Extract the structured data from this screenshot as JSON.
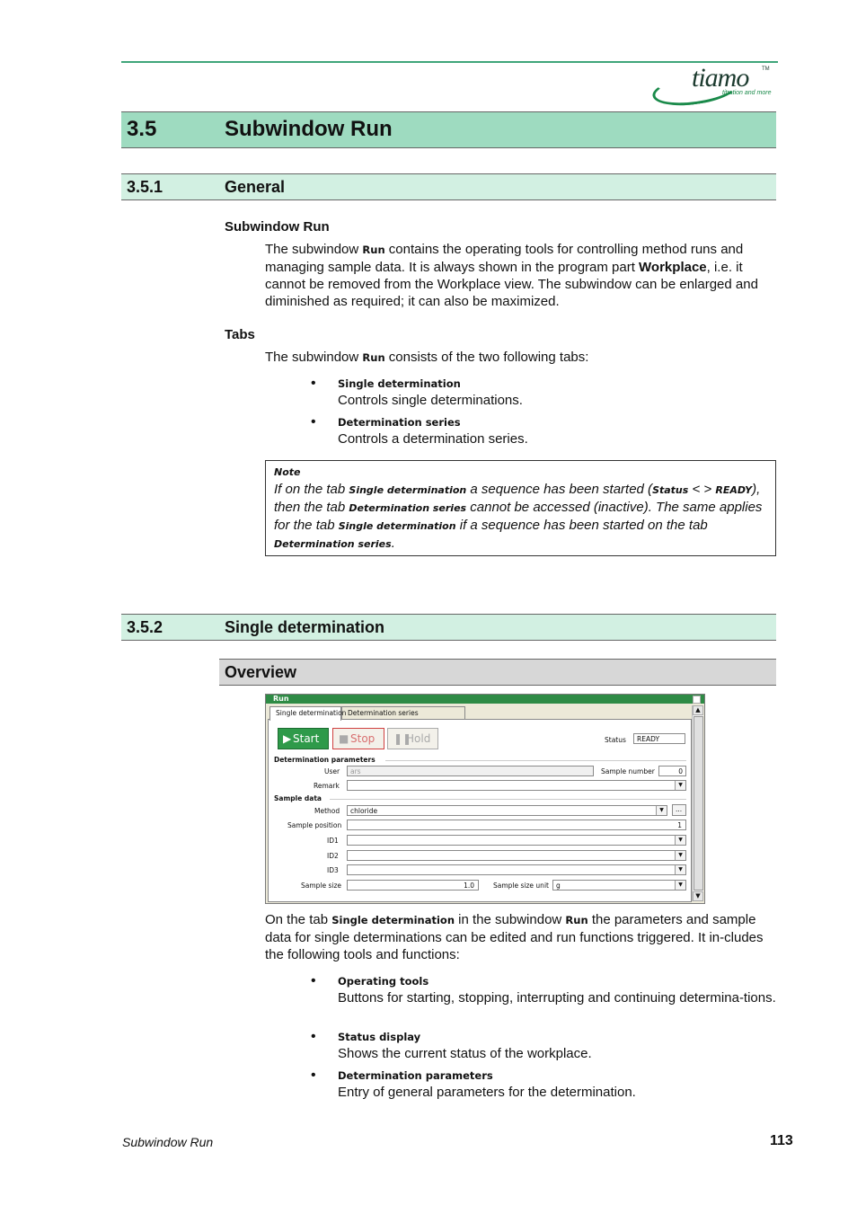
{
  "header": {
    "logo": {
      "word": "tiamo",
      "trademark": "TM",
      "tagline": "titration and more"
    }
  },
  "section": {
    "number": "3.5",
    "title": "Subwindow Run"
  },
  "general": {
    "number": "3.5.1",
    "title": "General",
    "subhead1": "Subwindow Run",
    "para1": {
      "t1": "The subwindow ",
      "ui1": "Run",
      "t2": " contains the operating tools for controlling method runs and managing sample data. It is always shown in the program part ",
      "b1": "Workplace",
      "t3": ", i.e. it cannot be removed from the Workplace view. The subwindow can be enlarged and diminished as required; it can also be maximized."
    },
    "subhead2": "Tabs",
    "para2": {
      "t1": "The subwindow ",
      "ui1": "Run",
      "t2": " consists of the two following tabs:"
    },
    "bullets": [
      {
        "title": "Single determination",
        "desc": "Controls single determinations."
      },
      {
        "title": "Determination series",
        "desc": "Controls a determination series."
      }
    ],
    "note": {
      "title": "Note",
      "t1": "If on the tab ",
      "ui1": "Single determination",
      "t2": " a sequence has been started (",
      "ui2": "Status",
      "t3": " < > ",
      "ui3": "READY",
      "t4": "), then the tab ",
      "ui4": "Determination series",
      "t5": " cannot be accessed (inactive). The same applies for the tab ",
      "ui5": "Single determination",
      "t6": " if a sequence has been started on the tab ",
      "ui6": "Determination series",
      "t7": "."
    }
  },
  "single": {
    "number": "3.5.2",
    "title": "Single determination",
    "overview": "Overview",
    "window": {
      "title": "Run",
      "tabs": [
        "Single determination",
        "Determination series"
      ],
      "buttons": {
        "start": "Start",
        "stop": "Stop",
        "hold": "Hold"
      },
      "status_label": "Status",
      "status_value": "READY",
      "group1": "Determination parameters",
      "user_label": "User",
      "user_value": "ars",
      "sample_number_label": "Sample number",
      "sample_number_value": "0",
      "remark_label": "Remark",
      "remark_value": "",
      "group2": "Sample data",
      "method_label": "Method",
      "method_value": "chloride",
      "method_browse": "...",
      "sample_position_label": "Sample position",
      "sample_position_value": "1",
      "id1_label": "ID1",
      "id2_label": "ID2",
      "id3_label": "ID3",
      "sample_size_label": "Sample size",
      "sample_size_value": "1.0",
      "sample_size_unit_label": "Sample size unit",
      "sample_size_unit_value": "g"
    },
    "para": {
      "t1": "On the tab ",
      "ui1": "Single determination",
      "t2": " in the subwindow ",
      "ui2": "Run",
      "t3": " the parameters and sample data for single determinations can be edited and run functions triggered. It in-cludes the following tools and functions:"
    },
    "bullets": [
      {
        "title": "Operating tools",
        "desc": "Buttons for starting, stopping, interrupting and continuing determina-tions."
      },
      {
        "title": "Status display",
        "desc": "Shows the current status of the workplace."
      },
      {
        "title": "Determination parameters",
        "desc": "Entry of general parameters for the determination."
      }
    ]
  },
  "footer": {
    "left": "Subwindow Run",
    "page": "113"
  },
  "colors": {
    "h1": "#9edbc0",
    "h2": "#d2f0e2",
    "h3": "#d7d7d7",
    "titlebar": "#2e8b45",
    "start_button": "#2e9a4a",
    "stop_text": "#d04040"
  }
}
